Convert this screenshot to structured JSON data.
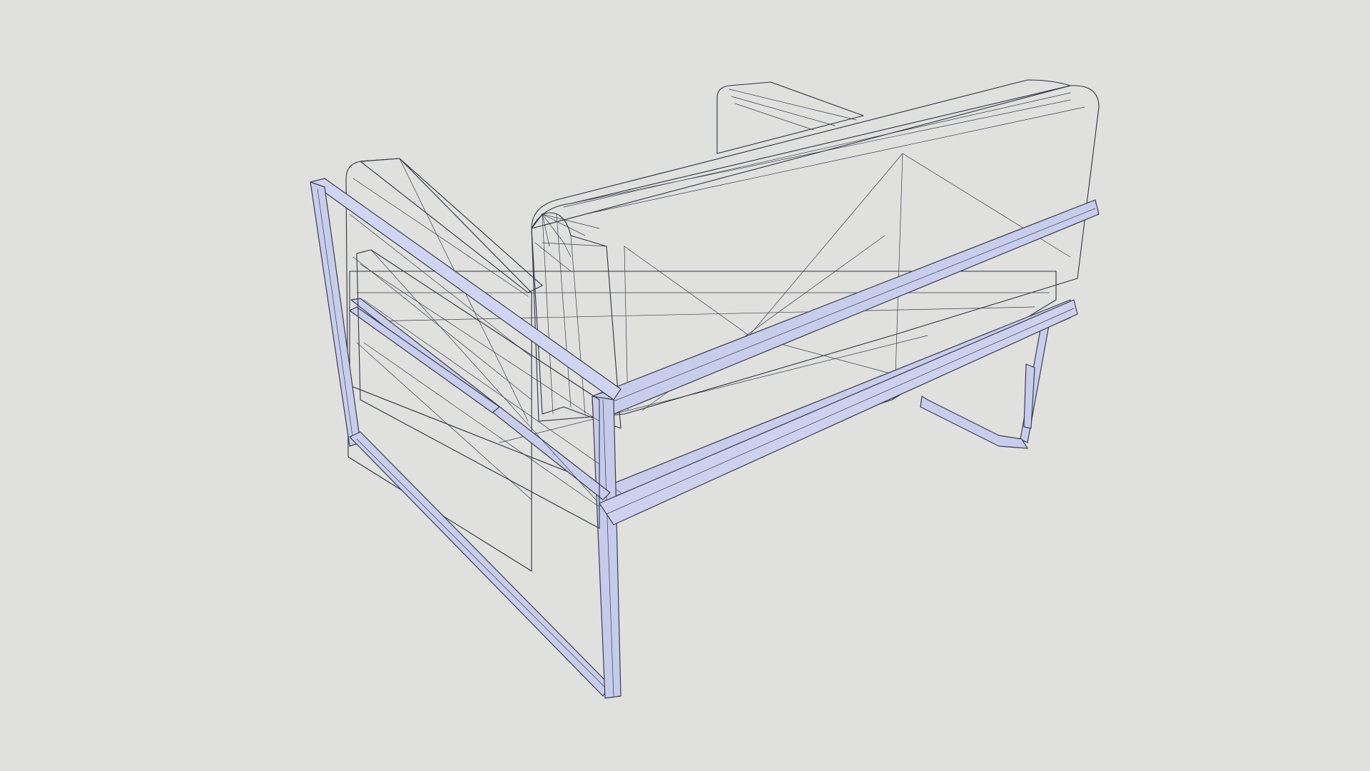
{
  "viewport": {
    "background_color": "#e0e0df"
  },
  "model": {
    "subject": "armchair-wireframe",
    "colors": {
      "face_light": "#dde0f4",
      "face_mid": "#c8cdef",
      "face_dark": "#aab2e6",
      "frame": "#c9cdec",
      "edge": "#2f3340"
    }
  }
}
